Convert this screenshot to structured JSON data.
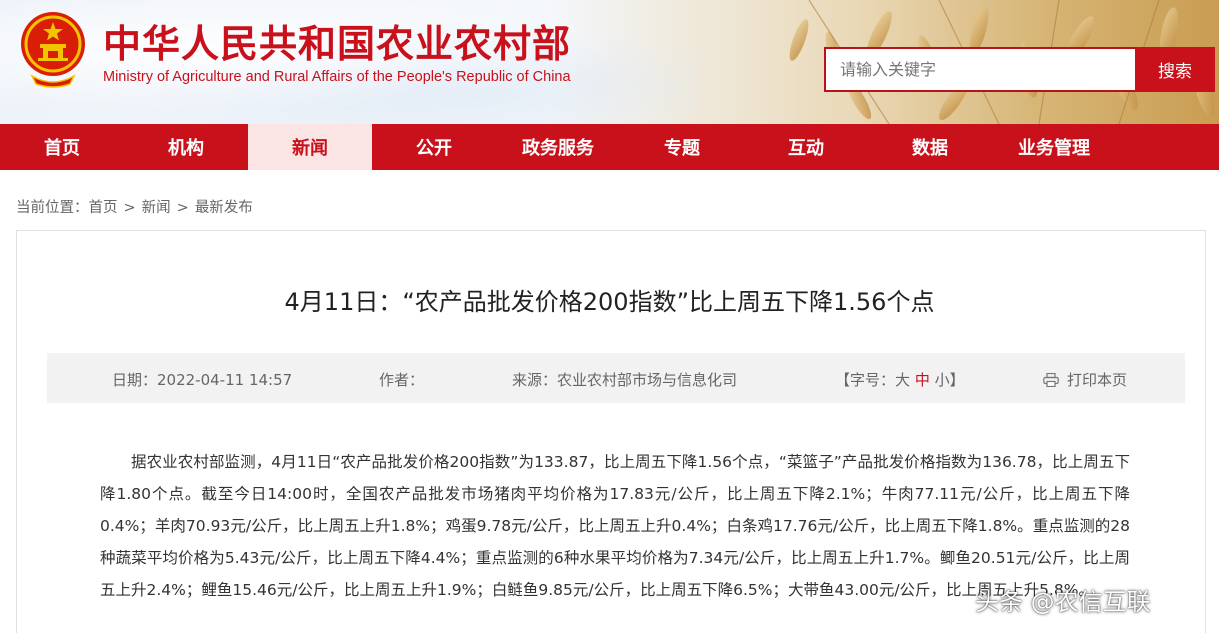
{
  "header": {
    "site_title": "中华人民共和国农业农村部",
    "site_subtitle": "Ministry of Agriculture and Rural Affairs of the People's Republic of China",
    "search_placeholder": "请输入关键字",
    "search_button": "搜索"
  },
  "nav": {
    "items": [
      {
        "label": "首页"
      },
      {
        "label": "机构"
      },
      {
        "label": "新闻"
      },
      {
        "label": "公开"
      },
      {
        "label": "政务服务"
      },
      {
        "label": "专题"
      },
      {
        "label": "互动"
      },
      {
        "label": "数据"
      },
      {
        "label": "业务管理"
      }
    ],
    "active": "新闻"
  },
  "breadcrumb": {
    "prefix": "当前位置：",
    "items": [
      "首页",
      "新闻",
      "最新发布"
    ],
    "separator": ">"
  },
  "article": {
    "title": "4月11日：“农产品批发价格200指数”比上周五下降1.56个点",
    "meta": {
      "date": "日期：2022-04-11 14:57",
      "author": "作者：",
      "source": "来源：农业农村部市场与信息化司",
      "font_size_prefix": "【字号：",
      "font_size_large": "大",
      "font_size_medium": "中",
      "font_size_small": "小",
      "font_size_suffix": "】",
      "print": "打印本页"
    },
    "body": "据农业农村部监测，4月11日“农产品批发价格200指数”为133.87，比上周五下降1.56个点，“菜篮子”产品批发价格指数为136.78，比上周五下降1.80个点。截至今日14:00时，全国农产品批发市场猪肉平均价格为17.83元/公斤，比上周五下降2.1%；牛肉77.11元/公斤，比上周五下降0.4%；羊肉70.93元/公斤，比上周五上升1.8%；鸡蛋9.78元/公斤，比上周五上升0.4%；白条鸡17.76元/公斤，比上周五下降1.8%。重点监测的28种蔬菜平均价格为5.43元/公斤，比上周五下降4.4%；重点监测的6种水果平均价格为7.34元/公斤，比上周五上升1.7%。鲫鱼20.51元/公斤，比上周五上升2.4%；鲤鱼15.46元/公斤，比上周五上升1.9%；白鲢鱼9.85元/公斤，比上周五下降6.5%；大带鱼43.00元/公斤，比上周五上升5.8%。"
  },
  "watermark": "头条 @农信互联",
  "colors": {
    "brand_red": "#c8111b",
    "nav_active_bg": "#fbe5e4",
    "meta_bg": "#f2f2f2"
  }
}
